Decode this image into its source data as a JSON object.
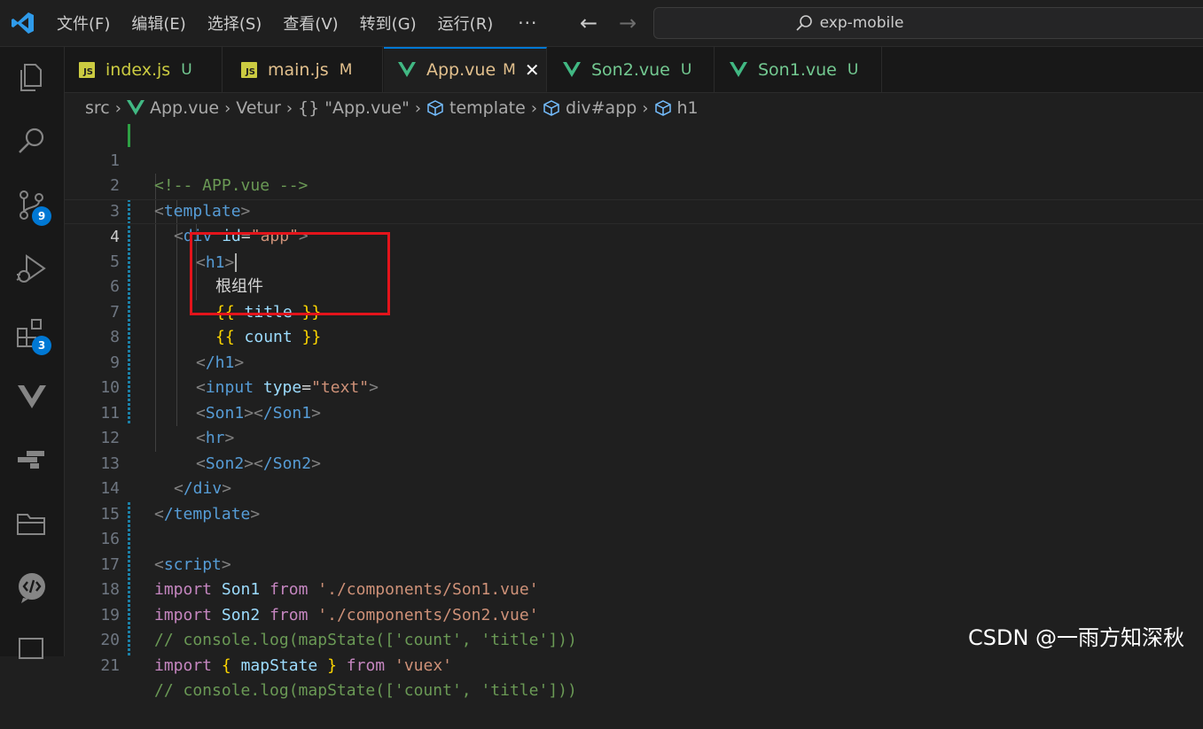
{
  "menu": {
    "items": [
      "文件(F)",
      "编辑(E)",
      "选择(S)",
      "查看(V)",
      "转到(G)",
      "运行(R)"
    ],
    "more": "···"
  },
  "search": {
    "text": "exp-mobile"
  },
  "activity": {
    "source_control_badge": "9",
    "extensions_badge": "3"
  },
  "tabs": [
    {
      "label": "index.js",
      "status": "U",
      "type": "js"
    },
    {
      "label": "main.js",
      "status": "M",
      "type": "js"
    },
    {
      "label": "App.vue",
      "status": "M",
      "type": "vue",
      "active": true
    },
    {
      "label": "Son2.vue",
      "status": "U",
      "type": "vue"
    },
    {
      "label": "Son1.vue",
      "status": "U",
      "type": "vue"
    }
  ],
  "tab_close": "✕",
  "breadcrumb": {
    "src": "src",
    "file": "App.vue",
    "vetur": "Vetur",
    "braces": "{}",
    "app_vue": "\"App.vue\"",
    "template": "template",
    "div": "div#app",
    "h1": "h1"
  },
  "code_lines": [
    "1",
    "2",
    "3",
    "4",
    "5",
    "6",
    "7",
    "8",
    "9",
    "10",
    "11",
    "12",
    "13",
    "14",
    "15",
    "16",
    "17",
    "18",
    "19",
    "20",
    "21"
  ],
  "code": {
    "l1": "<!-- APP.vue -->",
    "l2_open": "<",
    "l2_tag": "template",
    "l2_close": ">",
    "l3_indent": "  ",
    "l3_tag": "div",
    "l3_attr": "id",
    "l3_val": "\"app\"",
    "l4_tag": "h1",
    "l5_text": "根组件",
    "l6_var": "title",
    "l7_var": "count",
    "l8_tag": "/h1",
    "l9_tag": "input",
    "l9_attr": "type",
    "l9_val": "\"text\"",
    "l10_tag1": "Son1",
    "l10_tag2": "/Son1",
    "l11_tag": "hr",
    "l12_tag1": "Son2",
    "l12_tag2": "/Son2",
    "l13_tag": "/div",
    "l14_tag": "/template",
    "l16_tag": "script",
    "l17_kw": "import",
    "l17_var": "Son1",
    "l17_from": "from",
    "l17_str": "'./components/Son1.vue'",
    "l18_kw": "import",
    "l18_var": "Son2",
    "l18_from": "from",
    "l18_str": "'./components/Son2.vue'",
    "l19": "// console.log(mapState(['count', 'title']))",
    "l20_kw": "import",
    "l20_var": "mapState",
    "l20_from": "from",
    "l20_str": "'vuex'",
    "l21": "// console.log(mapState(['count', 'title']))"
  },
  "brace_open": "{{",
  "brace_close": "}}",
  "watermark": "CSDN @一雨方知深秋"
}
